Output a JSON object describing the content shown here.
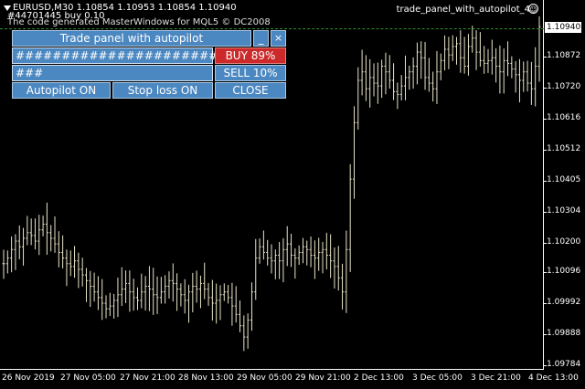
{
  "header": {
    "symbol_line": "EURUSD,M30  1.10854 1.10953 1.10854 1.10940",
    "order_line": "#44701445 buy 0.10",
    "copyright_line": "The code generated MasterWindows for MQL5 © DC2008",
    "ea_name": "trade_panel_with_autopilot_4",
    "smiley": "☺"
  },
  "panel": {
    "title": "Trade panel with autopilot",
    "minimize": "_",
    "close_icon": "×",
    "buy_field": "##########################",
    "buy_button": "BUY 89%",
    "sell_field": "###",
    "sell_button": "SELL 10%",
    "autopilot_button": "Autopilot  ON",
    "stoploss_button": "Stop loss  ON",
    "close_button": "CLOSE"
  },
  "price_axis": {
    "current": "1.10940",
    "labels": [
      "1.10872",
      "1.10720",
      "1.10616",
      "1.10512",
      "1.10405",
      "1.10304",
      "1.10200",
      "1.10096",
      "1.09992",
      "1.09888",
      "1.09784"
    ]
  },
  "time_axis": {
    "labels": [
      "26 Nov 2019",
      "27 Nov 05:00",
      "27 Nov 21:00",
      "28 Nov 13:00",
      "29 Nov 05:00",
      "29 Nov 21:00",
      "2 Dec 13:00",
      "3 Dec 05:00",
      "3 Dec 21:00",
      "4 Dec 13:00"
    ]
  },
  "chart_data": {
    "type": "ohlc",
    "symbol": "EURUSD",
    "timeframe": "M30",
    "ylim": [
      1.0974,
      1.1097
    ],
    "close_series": [
      1.101,
      1.1012,
      1.1015,
      1.1018,
      1.1016,
      1.1019,
      1.1021,
      1.102,
      1.1018,
      1.1022,
      1.1024,
      1.1021,
      1.1019,
      1.1017,
      1.1014,
      1.1012,
      1.101,
      1.1009,
      1.1011,
      1.1008,
      1.1006,
      1.1004,
      1.1002,
      1.1,
      1.0998,
      1.0996,
      1.0994,
      1.0995,
      1.0997,
      1.0999,
      1.1001,
      1.1003,
      1.1,
      1.0998,
      1.0997,
      1.1,
      1.1002,
      1.1001,
      1.0999,
      1.0998,
      1.1,
      1.1002,
      1.1004,
      1.1003,
      1.1001,
      1.0999,
      1.0997,
      1.1,
      1.1002,
      1.1001,
      1.1003,
      1.1001,
      1.0998,
      1.0996,
      1.0997,
      1.0999,
      1.1,
      1.0998,
      1.0995,
      1.0992,
      1.0988,
      1.0984,
      1.099,
      1.1,
      1.1012,
      1.1016,
      1.1014,
      1.1012,
      1.1011,
      1.1013,
      1.1011,
      1.1015,
      1.1017,
      1.1013,
      1.1012,
      1.1014,
      1.1016,
      1.1015,
      1.1013,
      1.1012,
      1.1014,
      1.1015,
      1.1013,
      1.1011,
      1.1009,
      1.1005,
      1.1,
      1.1015,
      1.104,
      1.106,
      1.1075,
      1.1078,
      1.1072,
      1.1076,
      1.1074,
      1.1073,
      1.108,
      1.1078,
      1.1075,
      1.1071,
      1.107,
      1.1073,
      1.1076,
      1.1078,
      1.108,
      1.1085,
      1.1083,
      1.1076,
      1.1074,
      1.1072,
      1.1078,
      1.1082,
      1.1086,
      1.1084,
      1.1087,
      1.1088,
      1.1083,
      1.108,
      1.1087,
      1.109,
      1.1085,
      1.1082,
      1.1081,
      1.1082,
      1.1083,
      1.108,
      1.1078,
      1.1082,
      1.1081,
      1.1079,
      1.1077,
      1.1075,
      1.1078,
      1.1074,
      1.1072,
      1.108,
      1.1094
    ]
  }
}
